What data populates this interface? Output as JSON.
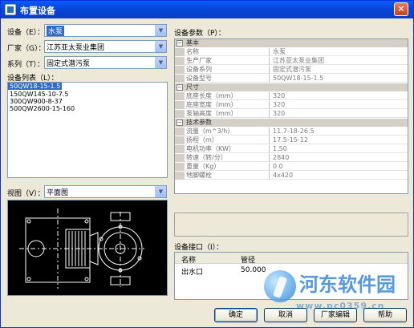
{
  "window": {
    "title": "布置设备",
    "close": "×"
  },
  "left": {
    "device_label": "设备（E）：",
    "device_value": "水泵",
    "maker_label": "厂家（G）：",
    "maker_value": "江苏亚太泵业集团",
    "series_label": "系列（T）：",
    "series_value": "固定式潜污泵",
    "list_label": "设备列表（L）：",
    "list_items": [
      "50QW18-15-1.5",
      "150QW145-10-7.5",
      "300QW900-8-37",
      "500QW2600-15-160"
    ],
    "view_label": "视图（V）：",
    "view_value": "平面图"
  },
  "params": {
    "label": "设备参数（P）：",
    "cat_basic": "基本",
    "basic": [
      {
        "name": "名称",
        "value": "水泵"
      },
      {
        "name": "生产厂家",
        "value": "江苏亚太泵业集团"
      },
      {
        "name": "设备系列",
        "value": "固定式潜污泵"
      },
      {
        "name": "设备型号",
        "value": "50QW18-15-1.5"
      }
    ],
    "cat_size": "尺寸",
    "size": [
      {
        "name": "底座长度（mm）",
        "value": "320"
      },
      {
        "name": "底座宽度（mm）",
        "value": "320"
      },
      {
        "name": "泵轴高度（mm）",
        "value": "320"
      }
    ],
    "cat_tech": "技术参数",
    "tech": [
      {
        "name": "流量（m^3/h）",
        "value": "11.7-18-26.5"
      },
      {
        "name": "扬程（m）",
        "value": "17.5-15-12"
      },
      {
        "name": "电机功率（KW）",
        "value": "1.50"
      },
      {
        "name": "转速（转/分）",
        "value": "2840"
      },
      {
        "name": "重量（Kg）",
        "value": "0.0"
      },
      {
        "name": "地脚螺栓",
        "value": "4x420"
      }
    ]
  },
  "interface": {
    "label": "设备接口（I）：",
    "col_name": "名称",
    "col_diameter": "管径",
    "row_name": "出水口",
    "row_diameter": "50.000"
  },
  "buttons": {
    "ok": "确定",
    "cancel": "取消",
    "maker": "厂家编辑",
    "help": "帮助"
  },
  "watermark": {
    "title": "河东软件园",
    "url": "www.pc0359.cn"
  }
}
